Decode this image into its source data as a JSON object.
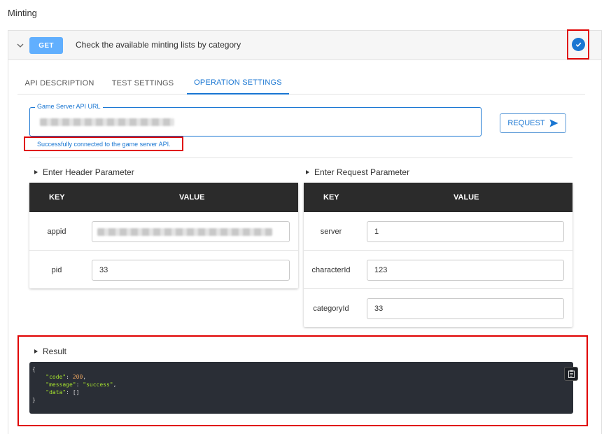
{
  "section": {
    "title": "Minting"
  },
  "endpoint": {
    "method": "GET",
    "description": "Check the available minting lists by category",
    "colors": {
      "method_badge": "#61affe",
      "check": "#1976d2"
    }
  },
  "tabs": [
    {
      "label": "API DESCRIPTION",
      "active": false
    },
    {
      "label": "TEST SETTINGS",
      "active": false
    },
    {
      "label": "OPERATION SETTINGS",
      "active": true
    }
  ],
  "url_field": {
    "label": "Game Server API URL",
    "value": "",
    "status_message": "Successfully connected to the game server API."
  },
  "request_button": {
    "label": "REQUEST"
  },
  "header_params": {
    "heading": "Enter Header Parameter",
    "columns": [
      "KEY",
      "VALUE"
    ],
    "rows": [
      {
        "key": "appid",
        "value": ""
      },
      {
        "key": "pid",
        "value": "33"
      }
    ]
  },
  "request_params": {
    "heading": "Enter Request Parameter",
    "columns": [
      "KEY",
      "VALUE"
    ],
    "rows": [
      {
        "key": "server",
        "value": "1"
      },
      {
        "key": "characterId",
        "value": "123"
      },
      {
        "key": "categoryId",
        "value": "33"
      }
    ]
  },
  "result": {
    "heading": "Result",
    "code": {
      "open": "{",
      "code_key": "\"code\"",
      "code_value": "200",
      "message_key": "\"message\"",
      "message_value": "\"success\"",
      "data_key": "\"data\"",
      "data_value": "[]",
      "close": "}"
    }
  }
}
